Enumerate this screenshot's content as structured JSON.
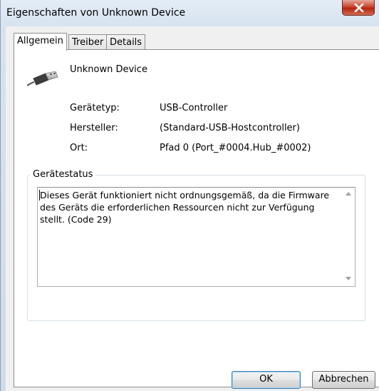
{
  "window": {
    "title": "Eigenschaften von Unknown Device"
  },
  "tabs": [
    {
      "label": "Allgemein",
      "active": true
    },
    {
      "label": "Treiber",
      "active": false
    },
    {
      "label": "Details",
      "active": false
    }
  ],
  "device": {
    "name": "Unknown Device",
    "icon": "usb-plug-icon",
    "properties": [
      {
        "label": "Gerätetyp:",
        "value": "USB-Controller"
      },
      {
        "label": "Hersteller:",
        "value": "(Standard-USB-Hostcontroller)"
      },
      {
        "label": "Ort:",
        "value": "Pfad 0 (Port_#0004.Hub_#0002)"
      }
    ]
  },
  "status": {
    "group_title": "Gerätestatus",
    "text": "Dieses Gerät funktioniert nicht ordnungsgemäß, da die Firmware des Geräts die erforderlichen Ressourcen nicht zur Verfügung stellt. (Code 29)"
  },
  "buttons": {
    "ok": "OK",
    "cancel": "Abbrechen"
  },
  "colors": {
    "close_button": "#c8462f",
    "default_button_border": "#3c7fb1"
  }
}
